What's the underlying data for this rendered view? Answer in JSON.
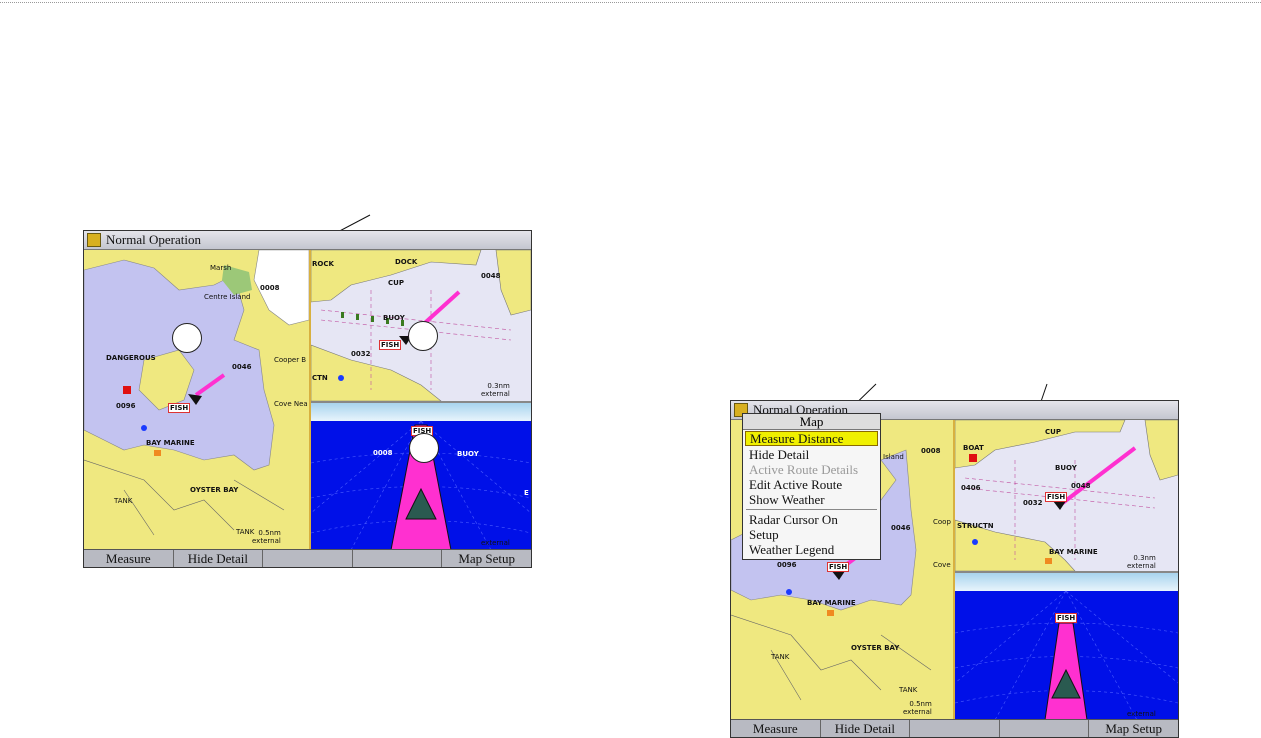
{
  "figure1": {
    "title": "Normal Operation",
    "softkeys": [
      "Measure",
      "Hide Detail",
      "",
      "",
      "Map Setup"
    ],
    "left_pane": {
      "labels": [
        "Centre Island",
        "DANGEROUS",
        "0096",
        "0046",
        "BAY MARINE",
        "OYSTER BAY",
        "Cove Nea",
        "Cooper B",
        "TANK",
        "TANK",
        "Marsh",
        "0008"
      ],
      "fish": "FISH",
      "scale_value": "0.5nm",
      "scale_source": "external"
    },
    "chart_pane": {
      "labels": [
        "DOCK",
        "CUP",
        "BUOY",
        "0032",
        "0048",
        "CTN",
        "ROCK"
      ],
      "fish": "FISH",
      "scale_value": "0.3nm",
      "scale_source": "external"
    },
    "perspective_pane": {
      "labels": [
        "0008",
        "BUOY",
        "E"
      ],
      "fish": "FISH",
      "scale_source": "external"
    }
  },
  "figure2": {
    "title": "Normal Operation",
    "softkeys": [
      "Measure",
      "Hide Detail",
      "",
      "",
      "Map Setup"
    ],
    "menu": {
      "title": "Map",
      "items": [
        {
          "label": "Measure Distance",
          "state": "selected"
        },
        {
          "label": "Hide Detail",
          "state": "normal"
        },
        {
          "label": "Active Route Details",
          "state": "disabled"
        },
        {
          "label": "Edit Active Route",
          "state": "normal"
        },
        {
          "label": "Show Weather",
          "state": "normal"
        },
        {
          "label": "Radar Cursor On",
          "state": "normal"
        },
        {
          "label": "Setup",
          "state": "normal"
        },
        {
          "label": "Weather Legend",
          "state": "normal"
        }
      ]
    },
    "left_pane": {
      "labels": [
        "Island",
        "0008",
        "0046",
        "0096",
        "BAY MARINE",
        "OYSTER BAY",
        "Coop",
        "Cove",
        "TANK",
        "TANK"
      ],
      "fish": "FISH",
      "scale_value": "0.5nm",
      "scale_source": "external"
    },
    "chart_pane": {
      "labels": [
        "BOAT",
        "CUP",
        "BUOY",
        "0406",
        "0032",
        "0048",
        "STRUCTN",
        "BAY MARINE"
      ],
      "fish": "FISH",
      "scale_value": "0.3nm",
      "scale_source": "external"
    },
    "perspective_pane": {
      "fish": "FISH",
      "scale_source": "external"
    }
  },
  "colors": {
    "land": "#efe880",
    "water": "#c3c3f0",
    "chart_water": "#e6e6f4",
    "sea_blue": "#0010e8",
    "course": "#ff30d0"
  }
}
